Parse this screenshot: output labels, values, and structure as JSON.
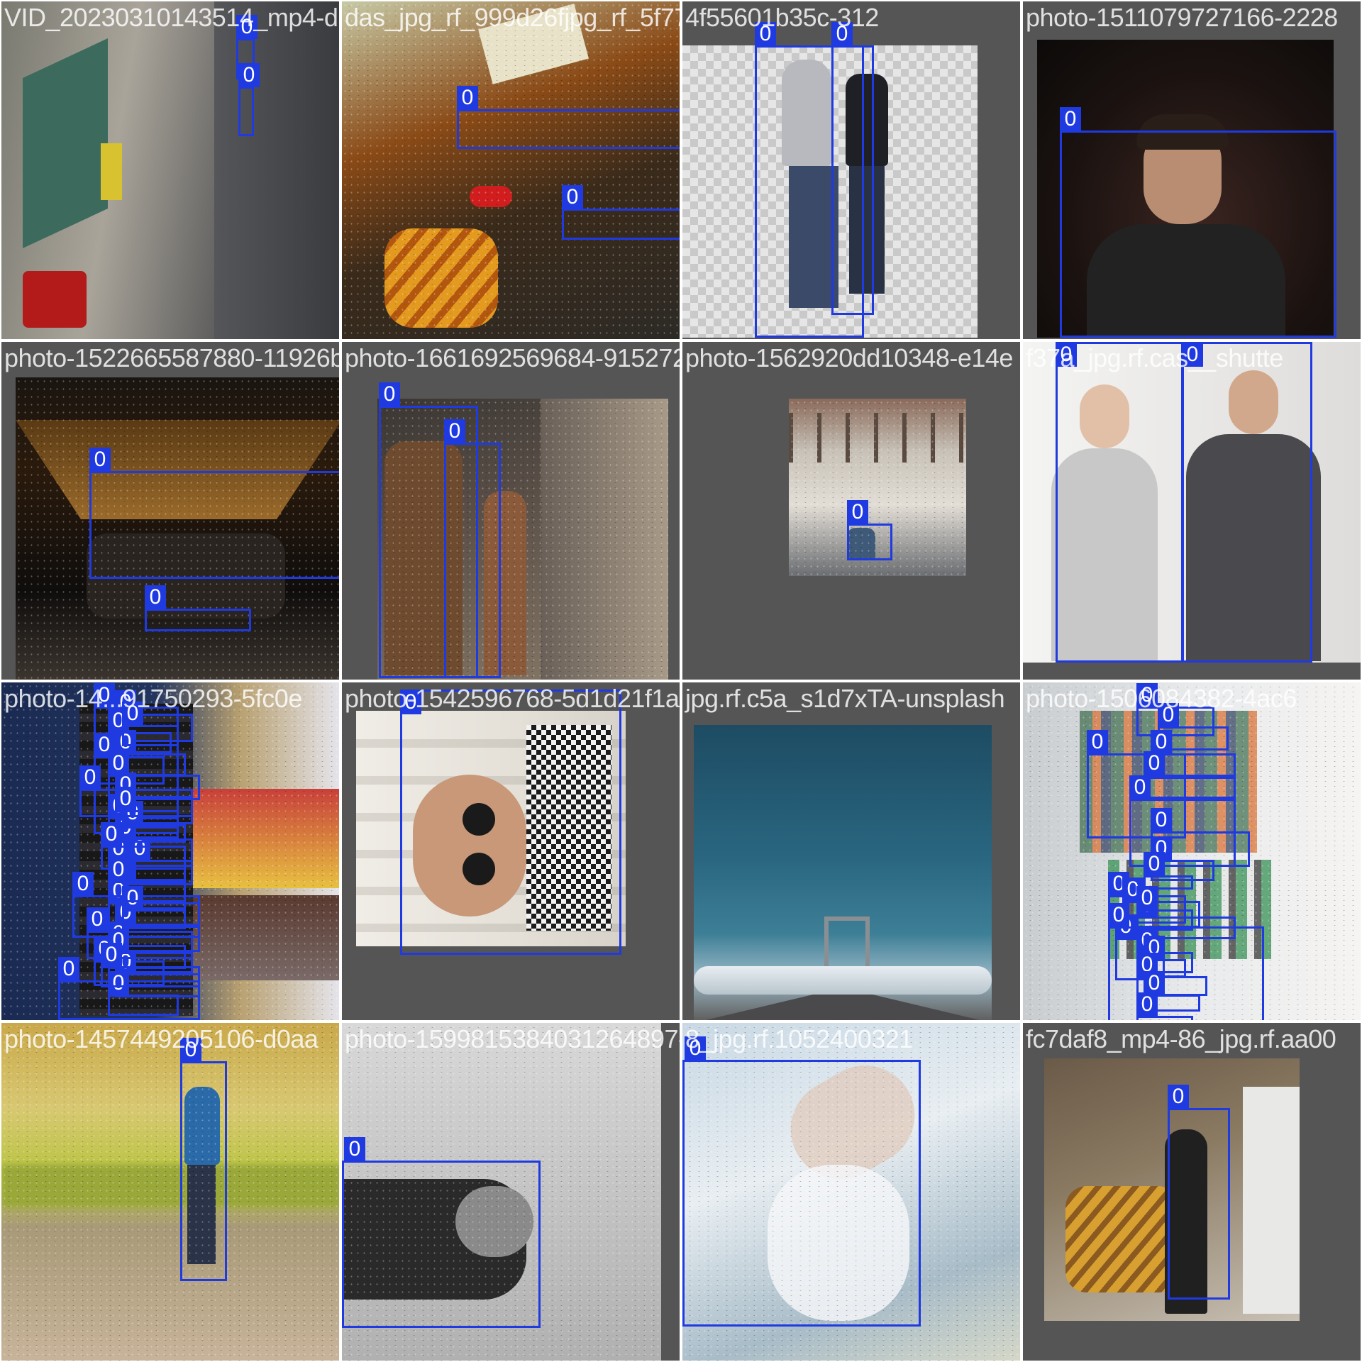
{
  "mosaic": {
    "tiles": [
      {
        "filename": "VID_20230310143514_mp4-da",
        "class_label": "0",
        "boxes": 2
      },
      {
        "filename": "das_jpg_rf_999d26fjpg_rf_5f77",
        "class_label": "0",
        "boxes": 2
      },
      {
        "filename": "4f55601b35c-312",
        "class_label": "0",
        "boxes": 2
      },
      {
        "filename": "photo-1511079727166-2228",
        "class_label": "0",
        "boxes": 1
      },
      {
        "filename": "photo-1522665587880-11926be57bb",
        "class_label": "0",
        "boxes": 2
      },
      {
        "filename": "photo-1661692569684-91527211033",
        "class_label": "0",
        "boxes": 2
      },
      {
        "filename": "photo-1562920dd10348-e14e",
        "class_label": "0",
        "boxes": 1
      },
      {
        "filename": "f37a_jpg.rf.cas__shutte",
        "class_label": "0",
        "boxes": 2
      },
      {
        "filename": "photo-14...91750293-5fc0e",
        "class_label": "0",
        "boxes": 30
      },
      {
        "filename": "photo-1542596768-5d1d21f1af98",
        "class_label": "0",
        "boxes": 1
      },
      {
        "filename": "jpg.rf.c5a_s1d7xTA-unsplash",
        "class_label": "0",
        "boxes": 0
      },
      {
        "filename": "photo-1506084382-4ac6",
        "class_label": "0",
        "boxes": 20
      },
      {
        "filename": "photo-1457449205106-d0aa",
        "class_label": "0",
        "boxes": 1
      },
      {
        "filename": "photo-1599815384031264897-aeab",
        "class_label": "0",
        "boxes": 2
      },
      {
        "filename": "8_jpg.rf.1052400321",
        "class_label": "0",
        "boxes": 1
      },
      {
        "filename": "fc7daf8_mp4-86_jpg.rf.aa00",
        "class_label": "0",
        "boxes": 1
      }
    ]
  },
  "colors": {
    "box": "#1f3ae0",
    "label_text": "#ffffff",
    "background": "#4b4b4b"
  }
}
